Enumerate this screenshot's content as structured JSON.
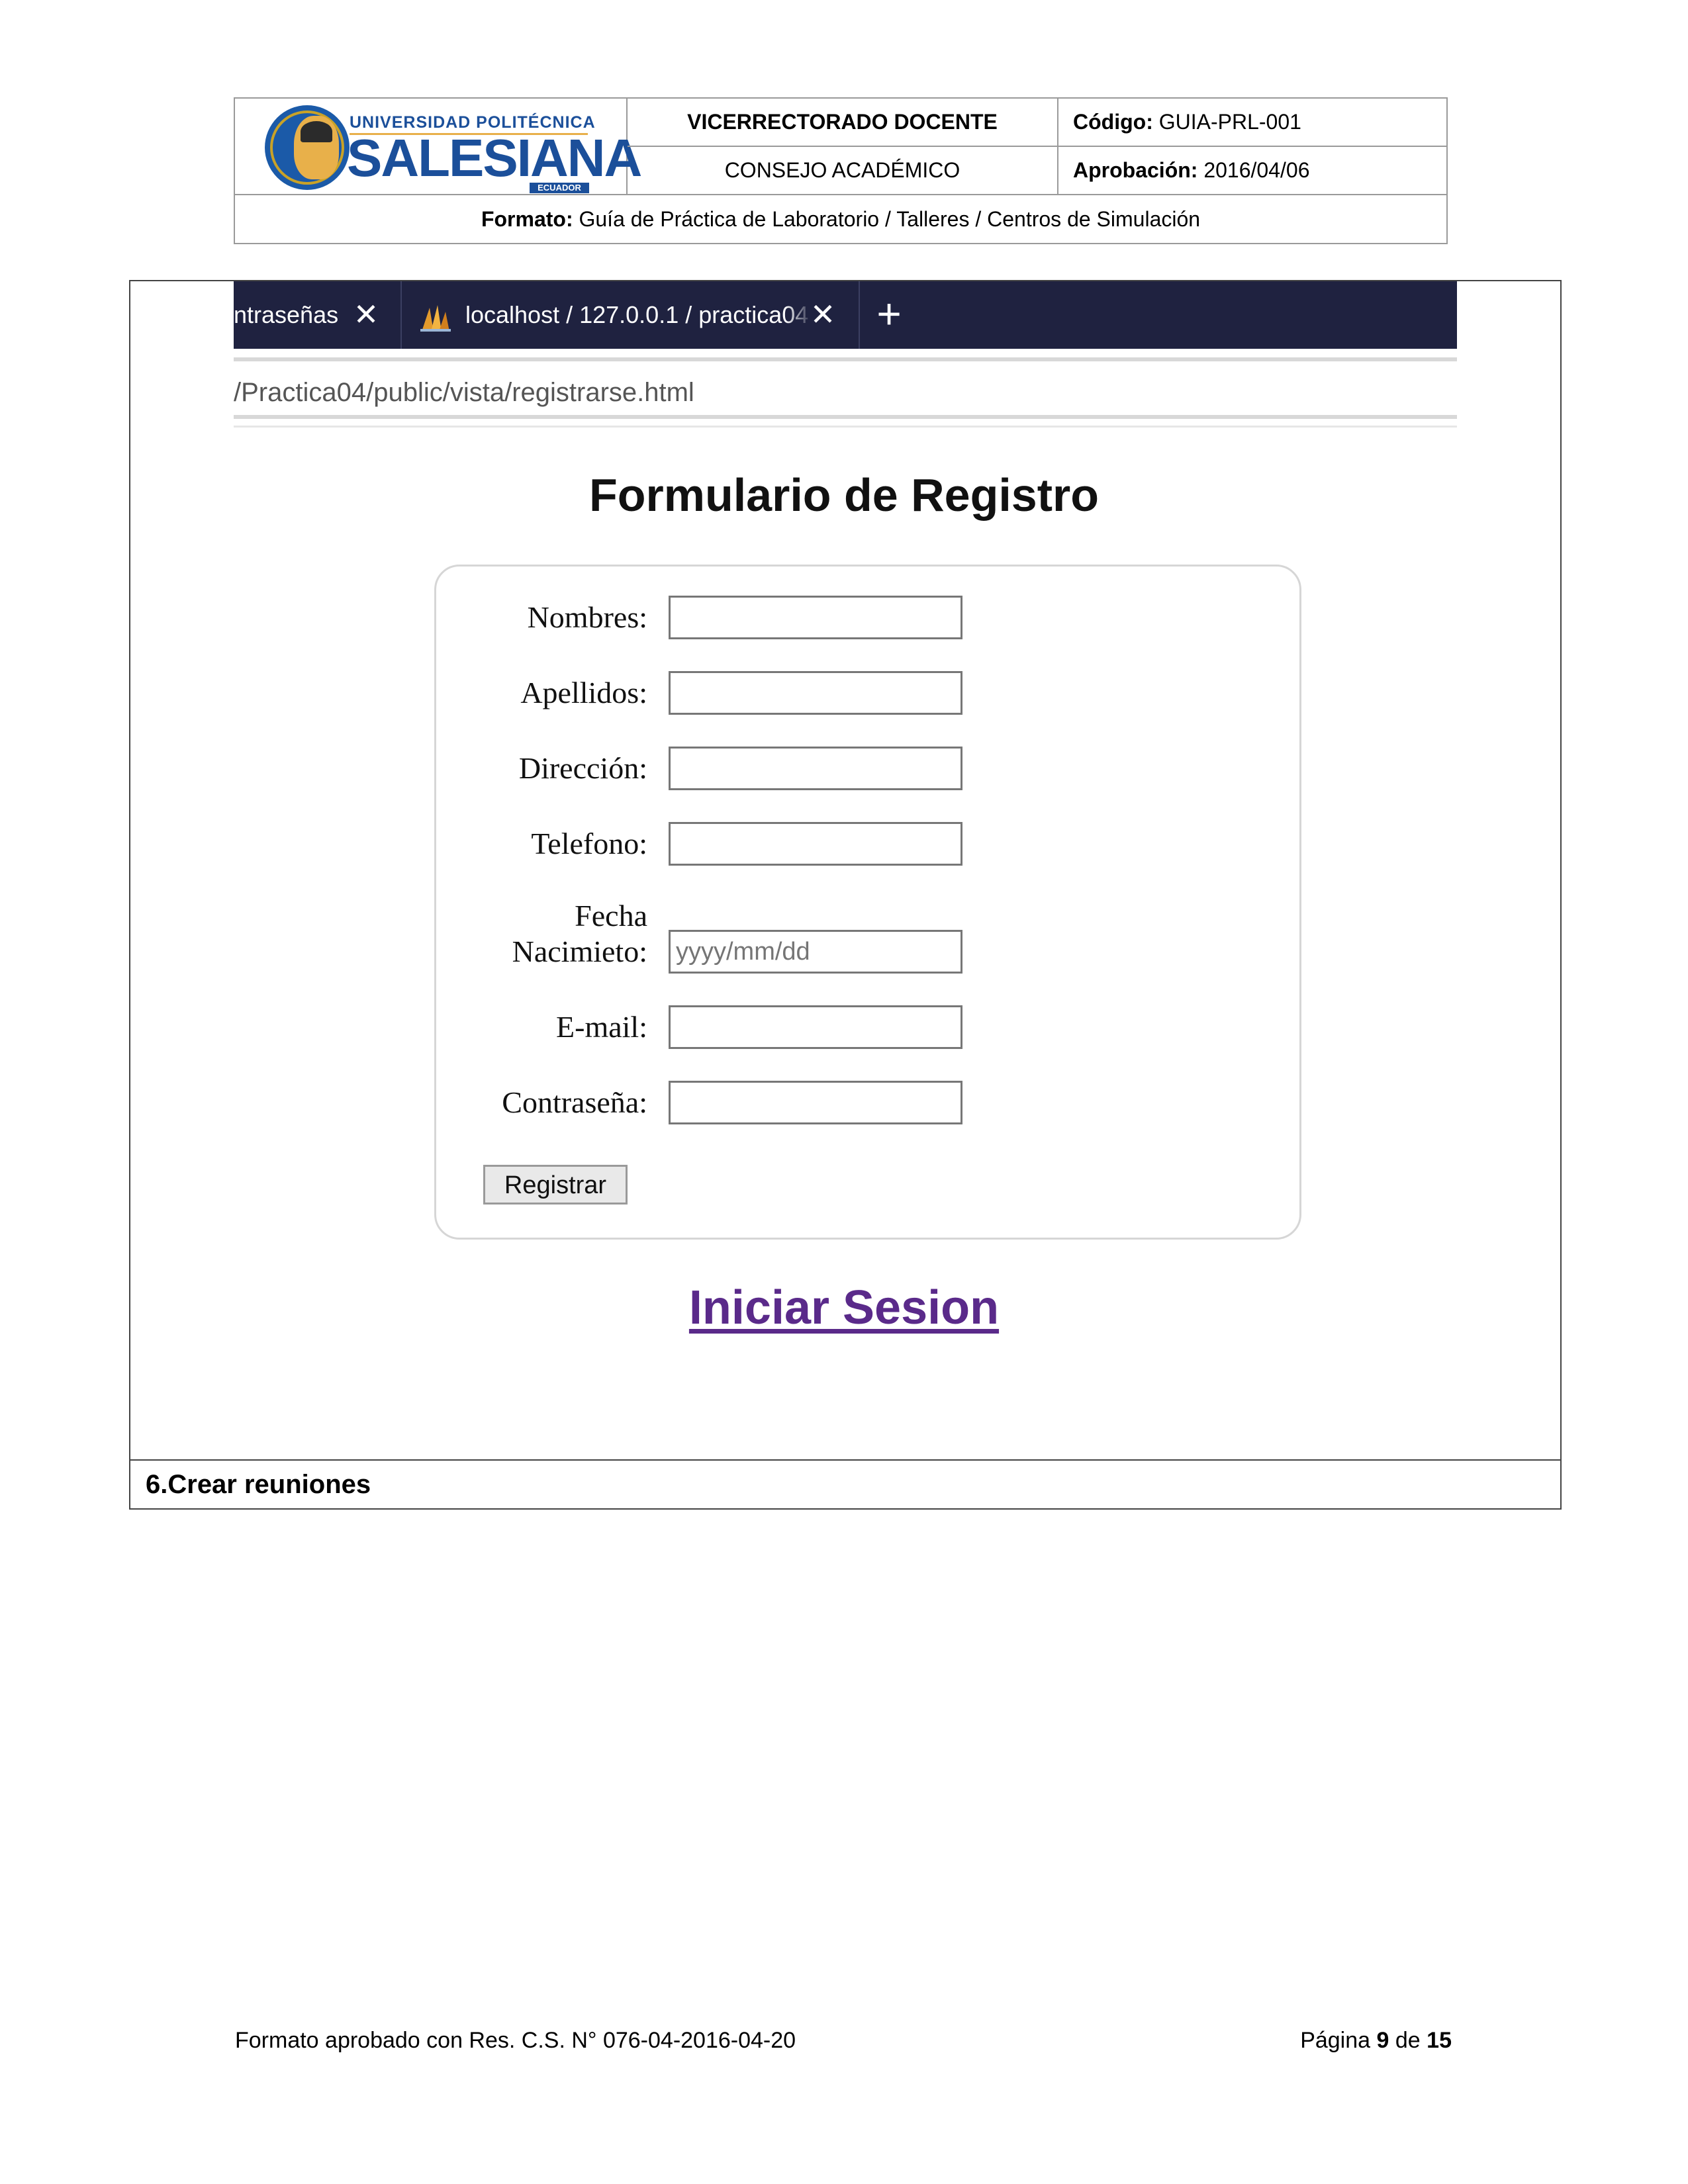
{
  "header": {
    "logo": {
      "top_line": "UNIVERSIDAD POLITÉCNICA",
      "main_word": "SALESIANA",
      "country": "ECUADOR"
    },
    "vicerrectorado": "VICERRECTORADO DOCENTE",
    "consejo": "CONSEJO ACADÉMICO",
    "codigo_label": "Código:",
    "codigo_value": "GUIA-PRL-001",
    "aprobacion_label": "Aprobación:",
    "aprobacion_value": "2016/04/06",
    "formato_label": "Formato:",
    "formato_value": "Guía de Práctica de Laboratorio / Talleres / Centros de Simulación"
  },
  "browser": {
    "tab1_title": "ntraseñas",
    "tab2_title": "localhost / 127.0.0.1 / practica04",
    "close_glyph": "✕",
    "new_tab_glyph": "+",
    "address": "/Practica04/public/vista/registrarse.html"
  },
  "form": {
    "title": "Formulario de Registro",
    "fields": [
      {
        "label": "Nombres:",
        "value": "",
        "placeholder": ""
      },
      {
        "label": "Apellidos:",
        "value": "",
        "placeholder": ""
      },
      {
        "label": "Dirección:",
        "value": "",
        "placeholder": ""
      },
      {
        "label": "Telefono:",
        "value": "",
        "placeholder": ""
      },
      {
        "label_line1": "Fecha",
        "label_line2": "Nacimieto:",
        "value": "",
        "placeholder": "yyyy/mm/dd"
      },
      {
        "label": "E-mail:",
        "value": "",
        "placeholder": ""
      },
      {
        "label": "Contraseña:",
        "value": "",
        "placeholder": ""
      }
    ],
    "submit_label": "Registrar"
  },
  "login_link": "Iniciar Sesion",
  "section_title": "6.Crear reuniones",
  "footer": {
    "left": "Formato aprobado con Res. C.S. N° 076-04-2016-04-20",
    "page_prefix": "Página",
    "page_current": "9",
    "page_of": "de",
    "page_total": "15"
  },
  "colors": {
    "tabbar": "#1f2240",
    "link": "#5a2a8a",
    "logo_blue": "#1b4f9a",
    "logo_gold": "#e8b04a"
  }
}
